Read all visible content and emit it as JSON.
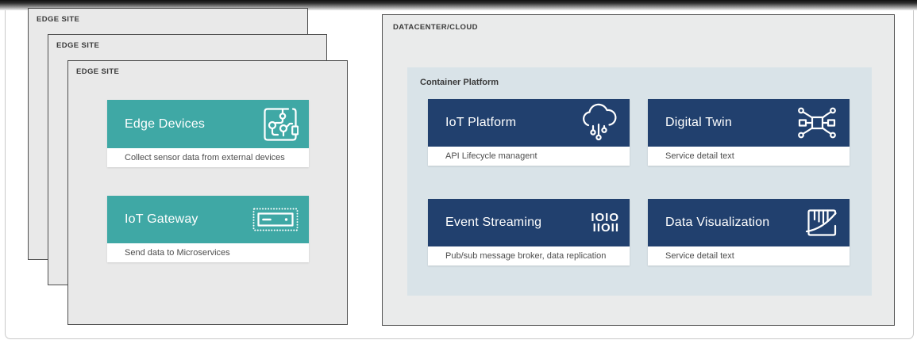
{
  "colors": {
    "teal": "#3FA8A5",
    "navy": "#21406E",
    "edge_site_bg": "#E9E9E9",
    "datacenter_bg": "#EAEBEB",
    "container_platform_bg": "#D9E3E8",
    "box_border": "#4F4F4F",
    "detail_text": "#4D4D4D",
    "zone_label_text": "#3A3A3A"
  },
  "edge_sites": {
    "stack_labels": [
      "EDGE SITE",
      "EDGE SITE",
      "EDGE SITE"
    ],
    "cards": [
      {
        "title": "Edge Devices",
        "detail": "Collect sensor data from external devices",
        "icon": "circuit-board-icon"
      },
      {
        "title": "IoT Gateway",
        "detail": "Send data to Microservices",
        "icon": "gateway-chip-icon"
      }
    ]
  },
  "datacenter": {
    "label": "DATACENTER/CLOUD",
    "container_platform": {
      "label": "Container Platform",
      "cards": [
        {
          "title": "IoT Platform",
          "detail": "API Lifecycle managent",
          "icon": "iot-cloud-icon"
        },
        {
          "title": "Digital Twin",
          "detail": "Service detail text",
          "icon": "digital-twin-icon"
        },
        {
          "title": "Event Streaming",
          "detail": "Pub/sub message broker, data replication",
          "icon": "binary-stream-icon",
          "icon_lines": [
            "IOIO",
            "IIOII"
          ]
        },
        {
          "title": "Data Visualization",
          "detail": "Service detail text",
          "icon": "bar-chart-curve-icon"
        }
      ]
    }
  }
}
